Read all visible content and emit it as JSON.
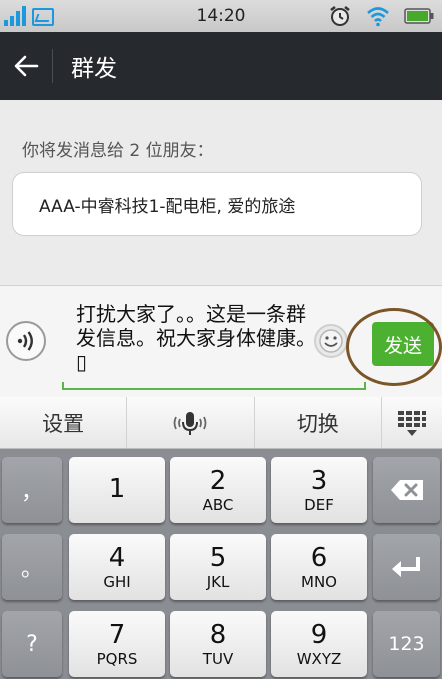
{
  "status_bar": {
    "time": "14:20"
  },
  "header": {
    "title": "群发"
  },
  "main": {
    "recipient_label": "你将发消息给 2 位朋友：",
    "recipients": "AAA-中睿科技1-配电柜, 爱的旅途"
  },
  "compose": {
    "message": "打扰大家了。。这是一条群发信息。祝大家身体健康。 ▯",
    "send_label": "发送"
  },
  "keyboard": {
    "toolbar": {
      "settings": "设置",
      "switch": "切换"
    },
    "side_keys": {
      "comma": "，",
      "period": "。",
      "question": "?",
      "mode": "123"
    },
    "keys": [
      {
        "num": "1",
        "letters": ""
      },
      {
        "num": "2",
        "letters": "ABC"
      },
      {
        "num": "3",
        "letters": "DEF"
      },
      {
        "num": "4",
        "letters": "GHI"
      },
      {
        "num": "5",
        "letters": "JKL"
      },
      {
        "num": "6",
        "letters": "MNO"
      },
      {
        "num": "7",
        "letters": "PQRS"
      },
      {
        "num": "8",
        "letters": "TUV"
      },
      {
        "num": "9",
        "letters": "WXYZ"
      }
    ]
  },
  "colors": {
    "accent": "#4cb131",
    "title_bar": "#262a2e",
    "highlight": "#7a5528"
  }
}
